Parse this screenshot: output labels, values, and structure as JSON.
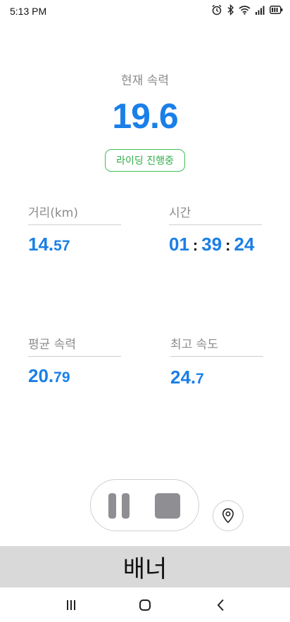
{
  "status_bar": {
    "time": "5:13 PM",
    "icons": [
      "alarm-icon",
      "bluetooth-icon",
      "wifi-icon",
      "signal-icon",
      "battery-icon"
    ]
  },
  "current_speed": {
    "label": "현재 속력",
    "value": "19.6"
  },
  "ride_status": "라이딩 진행중",
  "stats": {
    "distance": {
      "label": "거리(km)",
      "int_part": "14.",
      "dec_part": "57"
    },
    "time": {
      "label": "시간",
      "hours": "01",
      "minutes": "39",
      "seconds": "24",
      "separator": ":"
    },
    "avg_speed": {
      "label": "평균 속력",
      "int_part": "20.",
      "dec_part": "79"
    },
    "max_speed": {
      "label": "최고 속도",
      "int_part": "24.",
      "dec_part": "7"
    }
  },
  "controls": {
    "pause": "pause-icon",
    "stop": "stop-icon",
    "location": "location-pin-icon"
  },
  "banner": "배너",
  "nav": [
    "recent-apps-icon",
    "home-icon",
    "back-icon"
  ],
  "colors": {
    "accent": "#1a7fe8",
    "badge_green": "#2fae48",
    "control_gray": "#8e8e93",
    "banner_bg": "#d9d9d9"
  }
}
